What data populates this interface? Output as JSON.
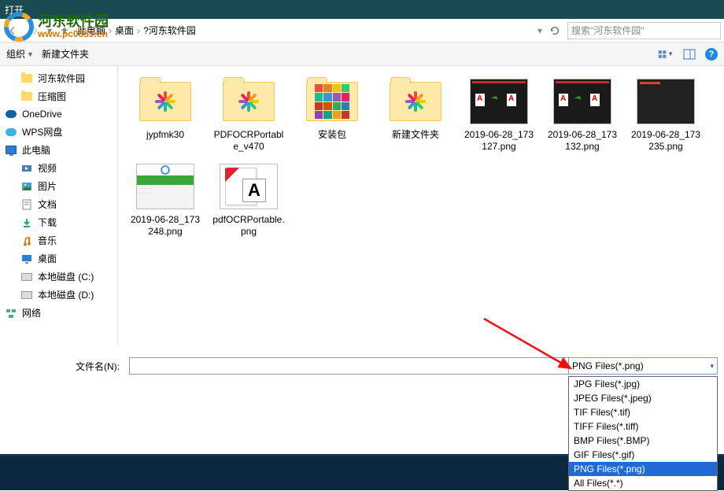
{
  "window": {
    "title": "打开"
  },
  "watermark": {
    "main": "河东软件园",
    "sub": "www.pc0359.cn"
  },
  "breadcrumb": {
    "parts": [
      "此电脑",
      "桌面",
      "?河东软件园"
    ]
  },
  "search": {
    "placeholder": "搜索\"河东软件园\""
  },
  "toolbar": {
    "organize": "组织",
    "new_folder": "新建文件夹"
  },
  "sidebar": {
    "items": [
      {
        "label": "河东软件园",
        "icon": "folder",
        "indent": true
      },
      {
        "label": "压缩图",
        "icon": "folder",
        "indent": true
      },
      {
        "label": "OneDrive",
        "icon": "onedrive"
      },
      {
        "label": "WPS网盘",
        "icon": "wps"
      },
      {
        "label": "此电脑",
        "icon": "pc"
      },
      {
        "label": "视频",
        "icon": "video",
        "indent": true
      },
      {
        "label": "图片",
        "icon": "pictures",
        "indent": true
      },
      {
        "label": "文档",
        "icon": "docs",
        "indent": true
      },
      {
        "label": "下载",
        "icon": "download",
        "indent": true
      },
      {
        "label": "音乐",
        "icon": "music",
        "indent": true
      },
      {
        "label": "桌面",
        "icon": "desktop",
        "indent": true
      },
      {
        "label": "本地磁盘 (C:)",
        "icon": "drive",
        "indent": true
      },
      {
        "label": "本地磁盘 (D:)",
        "icon": "drive",
        "indent": true
      },
      {
        "label": "网络",
        "icon": "network"
      }
    ]
  },
  "files": [
    {
      "name": "jypfmk30",
      "type": "folder-pinwheel"
    },
    {
      "name": "PDFOCRPortable_v470",
      "type": "folder-pinwheel"
    },
    {
      "name": "安装包",
      "type": "folder-rainbow"
    },
    {
      "name": "新建文件夹",
      "type": "folder-pinwheel"
    },
    {
      "name": "2019-06-28_173127.png",
      "type": "png-dark"
    },
    {
      "name": "2019-06-28_173132.png",
      "type": "png-dark"
    },
    {
      "name": "2019-06-28_173235.png",
      "type": "png-dark-getstart"
    },
    {
      "name": "2019-06-28_173248.png",
      "type": "png-green"
    },
    {
      "name": "pdfOCRPortable.png",
      "type": "png-pdfocr"
    }
  ],
  "filename": {
    "label": "文件名(N):",
    "value": ""
  },
  "filetype": {
    "selected": "PNG Files(*.png)",
    "options": [
      "JPG Files(*.jpg)",
      "JPEG Files(*.jpeg)",
      "TIF Files(*.tif)",
      "TIFF Files(*.tiff)",
      "BMP Files(*.BMP)",
      "GIF Files(*.gif)",
      "PNG Files(*.png)",
      "All Files(*.*)"
    ],
    "highlighted_index": 6
  }
}
